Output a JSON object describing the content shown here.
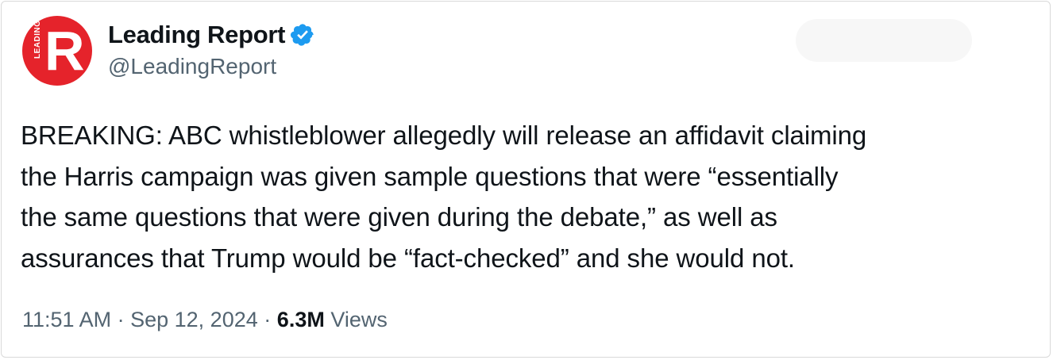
{
  "author": {
    "display_name": "Leading Report",
    "handle": "@LeadingReport",
    "avatar_letter": "R",
    "avatar_side_text": "LEADING",
    "verified": true,
    "avatar_color": "#e5232b",
    "verified_color": "#1d9bf0"
  },
  "tweet": {
    "lines": [
      "BREAKING: ABC whistleblower allegedly will release an affidavit claiming",
      "the Harris campaign was given sample questions that were “essentially",
      "the same questions that were given during the debate,” as well as",
      "assurances that Trump would be “fact-checked” and she would not."
    ]
  },
  "meta": {
    "time": "11:51 AM",
    "separator": "·",
    "date": "Sep 12, 2024",
    "views_count": "6.3M",
    "views_label": "Views"
  }
}
